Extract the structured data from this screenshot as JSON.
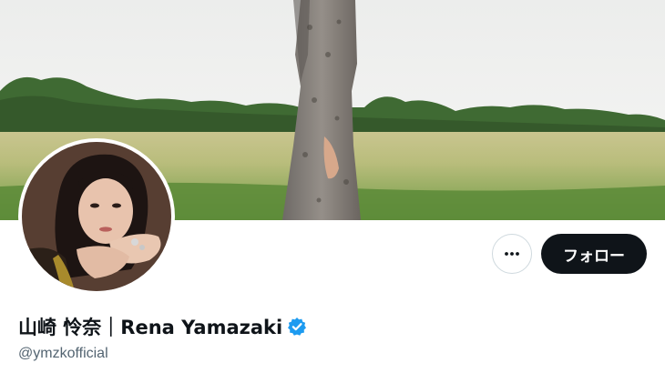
{
  "profile": {
    "display_name": "山崎 怜奈｜Rena Yamazaki",
    "handle": "@ymzkofficial",
    "verified": true
  },
  "actions": {
    "more_icon": "more-dots-icon",
    "follow_label": "フォロー"
  },
  "colors": {
    "follow_bg": "#0f1419",
    "verified_blue": "#1d9bf0",
    "handle_gray": "#536471",
    "border": "#cfd9de"
  }
}
